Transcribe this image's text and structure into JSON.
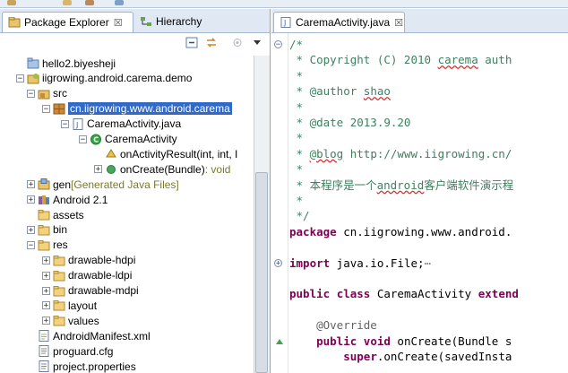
{
  "left_pane": {
    "tabs": [
      {
        "label": "Package Explorer",
        "active": true,
        "close": "☒"
      },
      {
        "label": "Hierarchy",
        "active": false
      }
    ],
    "tree": [
      {
        "label": "hello2.biyesheji",
        "icon": "project-icon",
        "depth": 1,
        "expander": ""
      },
      {
        "label": "iigrowing.android.carema.demo",
        "icon": "android-project-icon",
        "depth": 1,
        "expander": "−"
      },
      {
        "label": "src",
        "icon": "source-folder-icon",
        "depth": 2,
        "expander": "−"
      },
      {
        "label": "cn.iigrowing.www.android.carema",
        "icon": "package-icon",
        "depth": 3,
        "expander": "−",
        "selected": true
      },
      {
        "label": "CaremaActivity.java",
        "icon": "java-file-icon",
        "depth": 4,
        "expander": "−"
      },
      {
        "label": "CaremaActivity",
        "icon": "class-icon",
        "depth": 5,
        "expander": "−"
      },
      {
        "label": "onActivityResult(int, int, I",
        "icon": "protected-method-icon",
        "depth": 6,
        "expander": ""
      },
      {
        "label": "onCreate(Bundle)",
        "suffix": " : void",
        "icon": "public-method-icon",
        "depth": 6,
        "expander": "+"
      },
      {
        "label": "gen",
        "suffix": " [Generated Java Files]",
        "icon": "gen-folder-icon",
        "depth": 2,
        "expander": "+"
      },
      {
        "label": "Android 2.1",
        "icon": "library-icon",
        "depth": 2,
        "expander": "+"
      },
      {
        "label": "assets",
        "icon": "folder-icon",
        "depth": 2,
        "expander": ""
      },
      {
        "label": "bin",
        "icon": "folder-icon",
        "depth": 2,
        "expander": "+"
      },
      {
        "label": "res",
        "icon": "folder-icon",
        "depth": 2,
        "expander": "−"
      },
      {
        "label": "drawable-hdpi",
        "icon": "folder-icon",
        "depth": 3,
        "expander": "+"
      },
      {
        "label": "drawable-ldpi",
        "icon": "folder-icon",
        "depth": 3,
        "expander": "+"
      },
      {
        "label": "drawable-mdpi",
        "icon": "folder-icon",
        "depth": 3,
        "expander": "+"
      },
      {
        "label": "layout",
        "icon": "folder-icon",
        "depth": 3,
        "expander": "+"
      },
      {
        "label": "values",
        "icon": "folder-icon",
        "depth": 3,
        "expander": "+"
      },
      {
        "label": "AndroidManifest.xml",
        "icon": "xml-file-icon",
        "depth": 2,
        "expander": ""
      },
      {
        "label": "proguard.cfg",
        "icon": "text-file-icon",
        "depth": 2,
        "expander": ""
      },
      {
        "label": "project.properties",
        "icon": "text-file-icon",
        "depth": 2,
        "expander": ""
      }
    ]
  },
  "editor": {
    "tab_label": "CaremaActivity.java",
    "tab_close": "☒",
    "lines": [
      [
        {
          "t": "/*",
          "c": "cm"
        }
      ],
      [
        {
          "t": " * Copyright (C) 2010 ",
          "c": "cm"
        },
        {
          "t": "carema",
          "c": "cm squig"
        },
        {
          "t": " auth",
          "c": "cm"
        }
      ],
      [
        {
          "t": " *",
          "c": "cm"
        }
      ],
      [
        {
          "t": " * @author ",
          "c": "cm"
        },
        {
          "t": "shao",
          "c": "cm squig"
        }
      ],
      [
        {
          "t": " *",
          "c": "cm"
        }
      ],
      [
        {
          "t": " * @date 2013.9.20",
          "c": "cm"
        }
      ],
      [
        {
          "t": " *",
          "c": "cm"
        }
      ],
      [
        {
          "t": " * ",
          "c": "cm"
        },
        {
          "t": "@blog",
          "c": "cm squig"
        },
        {
          "t": " http://www.iigrowing.cn/",
          "c": "cm"
        }
      ],
      [
        {
          "t": " *",
          "c": "cm"
        }
      ],
      [
        {
          "t": " * 本程序是一个",
          "c": "cm"
        },
        {
          "t": "android",
          "c": "cm squig"
        },
        {
          "t": "客户端软件演示程",
          "c": "cm"
        }
      ],
      [
        {
          "t": " *",
          "c": "cm"
        }
      ],
      [
        {
          "t": " */",
          "c": "cm"
        }
      ],
      [
        {
          "t": "package",
          "c": "kw"
        },
        {
          "t": " cn.iigrowing.www.android.",
          "c": ""
        }
      ],
      [
        {
          "t": "",
          "c": ""
        }
      ],
      [
        {
          "t": "import",
          "c": "kw"
        },
        {
          "t": " java.io.File;",
          "c": ""
        },
        {
          "t": "⋯",
          "c": "grey"
        }
      ],
      [
        {
          "t": "",
          "c": ""
        }
      ],
      [
        {
          "t": "public",
          "c": "kw"
        },
        {
          "t": " ",
          "c": ""
        },
        {
          "t": "class",
          "c": "kw"
        },
        {
          "t": " CaremaActivity ",
          "c": ""
        },
        {
          "t": "extend",
          "c": "kw"
        }
      ],
      [
        {
          "t": "",
          "c": ""
        }
      ],
      [
        {
          "t": "    @Override",
          "c": "ann"
        }
      ],
      [
        {
          "t": "    ",
          "c": ""
        },
        {
          "t": "public",
          "c": "kw"
        },
        {
          "t": " ",
          "c": ""
        },
        {
          "t": "void",
          "c": "kw"
        },
        {
          "t": " onCreate(Bundle s",
          "c": ""
        }
      ],
      [
        {
          "t": "        ",
          "c": ""
        },
        {
          "t": "super",
          "c": "kw"
        },
        {
          "t": ".onCreate(savedInsta",
          "c": ""
        }
      ]
    ]
  }
}
